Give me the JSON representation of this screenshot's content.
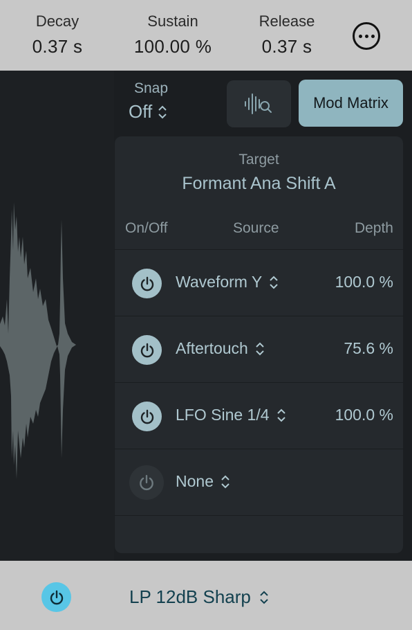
{
  "envelope": {
    "decay": {
      "label": "Decay",
      "value": "0.37 s"
    },
    "sustain": {
      "label": "Sustain",
      "value": "100.00 %"
    },
    "release": {
      "label": "Release",
      "value": "0.37 s"
    },
    "more_icon": "ellipsis-circle-icon"
  },
  "toolbar": {
    "snap_label": "Snap",
    "snap_value": "Off",
    "waveform_zoom_icon": "waveform-search-icon",
    "mod_matrix_label": "Mod Matrix",
    "mod_matrix_color": "#8fb5bf"
  },
  "matrix": {
    "target_label": "Target",
    "target_value": "Formant Ana Shift A",
    "headers": {
      "onoff": "On/Off",
      "source": "Source",
      "depth": "Depth"
    },
    "rows": [
      {
        "on": true,
        "source": "Waveform Y",
        "depth": "100.0 %"
      },
      {
        "on": true,
        "source": "Aftertouch",
        "depth": "75.6 %"
      },
      {
        "on": true,
        "source": "LFO Sine 1/4",
        "depth": "100.0 %"
      },
      {
        "on": false,
        "source": "None",
        "depth": ""
      }
    ]
  },
  "filter": {
    "power_on": true,
    "power_color": "#58c6e6",
    "type": "LP 12dB Sharp"
  }
}
